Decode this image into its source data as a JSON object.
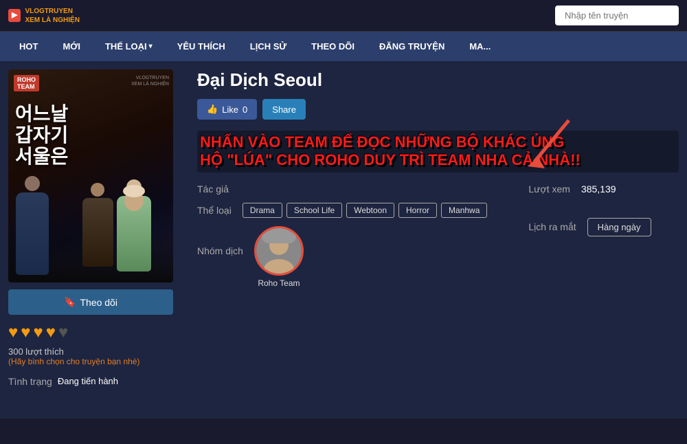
{
  "header": {
    "logo_line1": "VLOGTRUYEN",
    "logo_line2": "XEM LÀ NGHIỆN",
    "search_placeholder": "Nhập tên truyện"
  },
  "nav": {
    "items": [
      {
        "label": "HOT",
        "has_arrow": false
      },
      {
        "label": "MỚI",
        "has_arrow": false
      },
      {
        "label": "THỂ LOẠI",
        "has_arrow": true
      },
      {
        "label": "YÊU THÍCH",
        "has_arrow": false
      },
      {
        "label": "LỊCH SỬ",
        "has_arrow": false
      },
      {
        "label": "THEO DÕI",
        "has_arrow": false
      },
      {
        "label": "ĐĂNG TRUYỆN",
        "has_arrow": false
      },
      {
        "label": "MA...",
        "has_arrow": false
      }
    ]
  },
  "cover": {
    "badge": "ROHO\nTEAM",
    "watermark_line1": "VLOGTRUYEN",
    "watermark_line2": "XEM LÀ NGHIỆN",
    "korean_text_line1": "어느날",
    "korean_text_line2": "갑자기",
    "korean_text_line3": "서울은"
  },
  "manga": {
    "title": "Đại Dịch Seoul",
    "like_label": "Like",
    "like_count": "0",
    "share_label": "Share",
    "promo_line1": "NHẤN VÀO TEAM ĐỂ ĐỌC NHỮNG BỘ KHÁC ỦNG",
    "promo_line2": "HỘ \"LÚA\" CHO ROHO DUY TRÌ TEAM NHA CẢ NHÀ!!",
    "tac_gia_label": "Tác giả",
    "tac_gia_value": "",
    "the_loai_label": "Thể loại",
    "tags": [
      "Drama",
      "School Life",
      "Webtoon",
      "Horror",
      "Manhwa"
    ],
    "nhom_dich_label": "Nhóm dịch",
    "group_name": "Roho Team",
    "luot_xem_label": "Lượt xem",
    "luot_xem_value": "385,139",
    "lich_ra_mat_label": "Lịch ra mắt",
    "lich_ra_mat_value": "Hàng ngày",
    "follow_label": "Theo dõi",
    "stars": [
      true,
      true,
      true,
      true,
      false
    ],
    "likes_count": "300 lượt thích",
    "likes_vote_text": "(Hãy bình chọn cho truyện bạn nhé)",
    "tinh_trang_label": "Tình trạng",
    "tinh_trang_value": "Đang tiến hành"
  }
}
